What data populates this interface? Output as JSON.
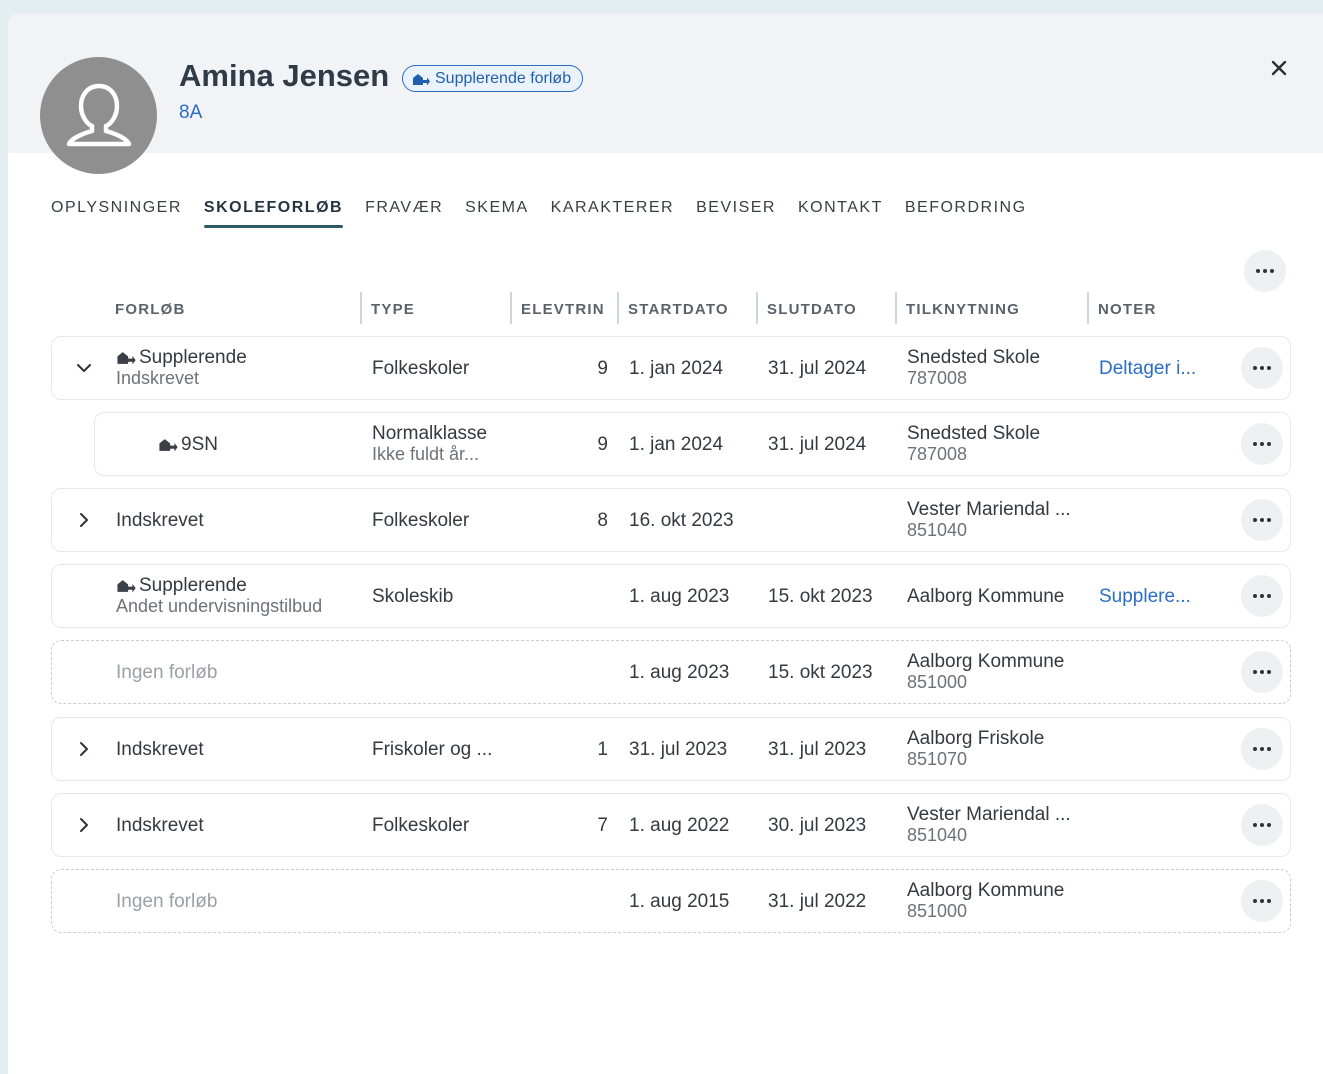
{
  "student": {
    "name": "Amina Jensen",
    "badge_label": "Supplerende forløb",
    "class": "8A"
  },
  "icons": {
    "avatar": "person-icon",
    "badge": "school-arrow-icon",
    "close": "close-icon",
    "more": "more-horizontal-icon",
    "expand": "chevron-down-icon",
    "collapsed": "chevron-right-icon"
  },
  "colors": {
    "accent": "#2a6ec4",
    "tab_underline": "#2e5a63",
    "header_bg": "#f1f3f6"
  },
  "tabs": [
    {
      "label": "OPLYSNINGER",
      "active": false
    },
    {
      "label": "SKOLEFORLØB",
      "active": true
    },
    {
      "label": "FRAVÆR",
      "active": false
    },
    {
      "label": "SKEMA",
      "active": false
    },
    {
      "label": "KARAKTERER",
      "active": false
    },
    {
      "label": "BEVISER",
      "active": false
    },
    {
      "label": "KONTAKT",
      "active": false
    },
    {
      "label": "BEFORDRING",
      "active": false
    }
  ],
  "table": {
    "columns": [
      "FORLØB",
      "TYPE",
      "ELEVTRIN",
      "STARTDATO",
      "SLUTDATO",
      "TILKNYTNING",
      "NOTER"
    ],
    "rows": [
      {
        "forlob": "Supplerende",
        "forlob_sub": "Indskrevet",
        "type": "Folkeskoler",
        "type_sub": "",
        "elevtrin": "9",
        "start": "1. jan 2024",
        "slut": "31. jul 2024",
        "tilknytning": "Snedsted Skole",
        "tilknytning_sub": "787008",
        "noter": "Deltager i..."
      },
      {
        "forlob": "9SN",
        "forlob_sub": "",
        "type": "Normalklasse",
        "type_sub": "Ikke fuldt år...",
        "elevtrin": "9",
        "start": "1. jan 2024",
        "slut": "31. jul 2024",
        "tilknytning": "Snedsted Skole",
        "tilknytning_sub": "787008",
        "noter": ""
      },
      {
        "forlob": "Indskrevet",
        "forlob_sub": "",
        "type": "Folkeskoler",
        "type_sub": "",
        "elevtrin": "8",
        "start": "16. okt 2023",
        "slut": "",
        "tilknytning": "Vester Mariendal ...",
        "tilknytning_sub": "851040",
        "noter": ""
      },
      {
        "forlob": "Supplerende",
        "forlob_sub": "Andet undervisningstilbud",
        "type": "Skoleskib",
        "type_sub": "",
        "elevtrin": "",
        "start": "1. aug 2023",
        "slut": "15. okt 2023",
        "tilknytning": "Aalborg Kommune",
        "tilknytning_sub": "",
        "noter": "Supplere..."
      },
      {
        "forlob": "Ingen forløb",
        "forlob_sub": "",
        "type": "",
        "type_sub": "",
        "elevtrin": "",
        "start": "1. aug 2023",
        "slut": "15. okt 2023",
        "tilknytning": "Aalborg Kommune",
        "tilknytning_sub": "851000",
        "noter": ""
      },
      {
        "forlob": "Indskrevet",
        "forlob_sub": "",
        "type": "Friskoler og ...",
        "type_sub": "",
        "elevtrin": "1",
        "start": "31. jul 2023",
        "slut": "31. jul 2023",
        "tilknytning": "Aalborg Friskole",
        "tilknytning_sub": "851070",
        "noter": ""
      },
      {
        "forlob": "Indskrevet",
        "forlob_sub": "",
        "type": "Folkeskoler",
        "type_sub": "",
        "elevtrin": "7",
        "start": "1. aug 2022",
        "slut": "30. jul 2023",
        "tilknytning": "Vester Mariendal ...",
        "tilknytning_sub": "851040",
        "noter": ""
      },
      {
        "forlob": "Ingen forløb",
        "forlob_sub": "",
        "type": "",
        "type_sub": "",
        "elevtrin": "",
        "start": "1. aug 2015",
        "slut": "31. jul 2022",
        "tilknytning": "Aalborg Kommune",
        "tilknytning_sub": "851000",
        "noter": ""
      }
    ]
  }
}
